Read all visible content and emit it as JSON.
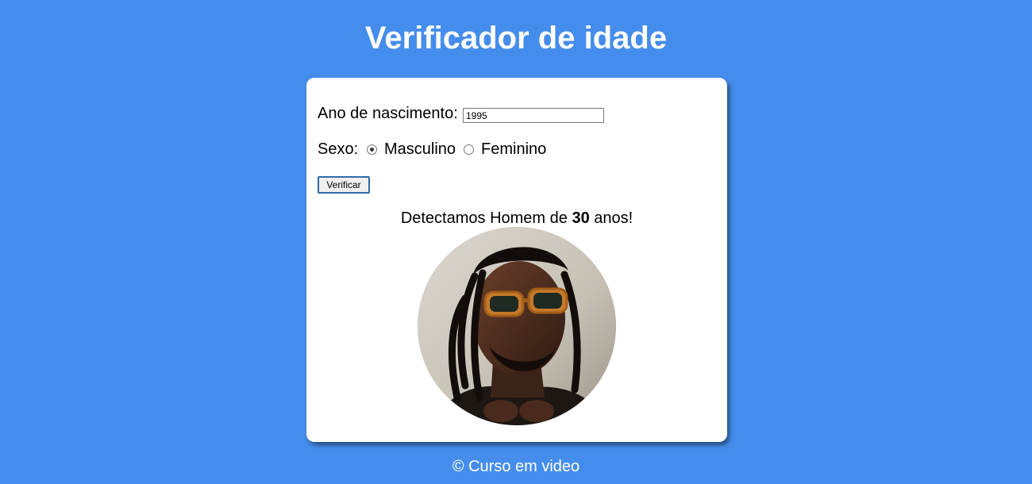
{
  "header": {
    "title": "Verificador de idade"
  },
  "form": {
    "year_label": "Ano de nascimento:",
    "year_value": "1995",
    "sex_label": "Sexo:",
    "options": [
      {
        "label": "Masculino",
        "checked": true
      },
      {
        "label": "Feminino",
        "checked": false
      }
    ],
    "button_label": "Verificar"
  },
  "result": {
    "prefix": "Detectamos Homem de ",
    "age": "30",
    "suffix": " anos!",
    "photo_alt": "Foto de homem com óculos de sol"
  },
  "footer": {
    "text": "© Curso em video"
  },
  "colors": {
    "background": "#458dec",
    "card": "#ffffff",
    "text": "#000000"
  }
}
